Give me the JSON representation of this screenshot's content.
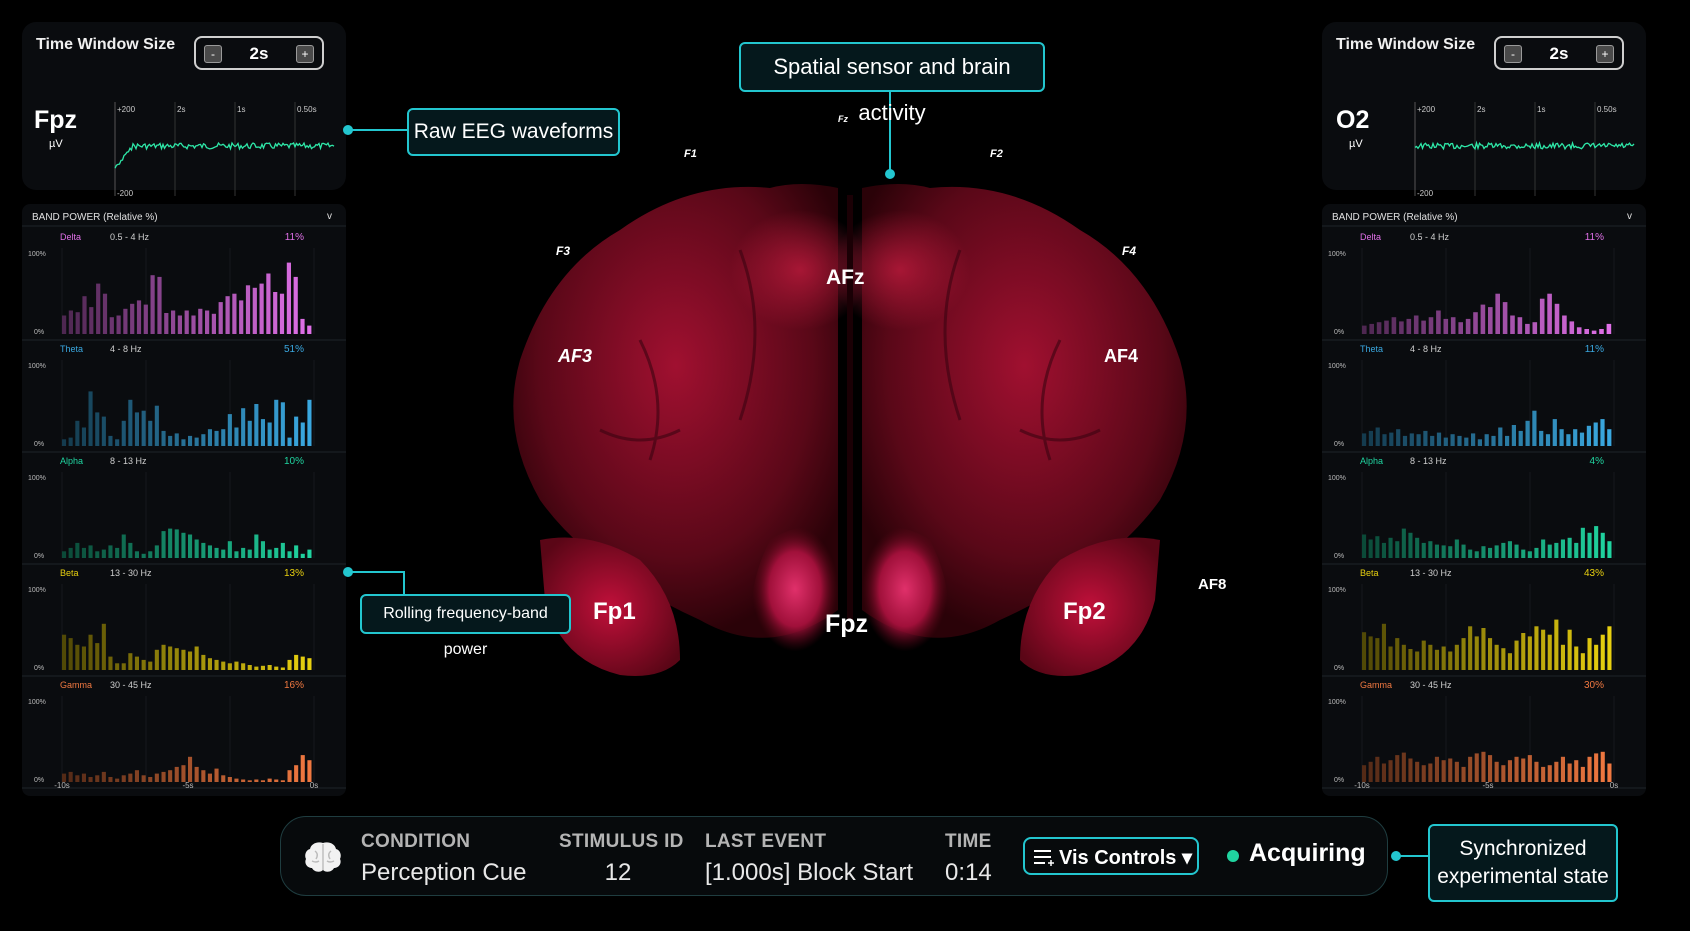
{
  "colors": {
    "accent": "#23c6cf",
    "delta": "#e070e8",
    "theta": "#3aa8e0",
    "alpha": "#20d4a0",
    "beta": "#e8d010",
    "gamma": "#f07840",
    "wave": "#2ee8a8",
    "acquiring_dot": "#20d4a0"
  },
  "left": {
    "time_window_label": "Time Window Size",
    "time_window_value": "2s",
    "minus": "-",
    "plus": "+",
    "channel": "Fpz",
    "unit": "µV",
    "y_top": "+200",
    "y_bottom": "-200",
    "x_ticks": [
      "2s",
      "1s",
      "0.50s"
    ],
    "band_header": "BAND POWER (Relative %)",
    "band_caret": "v",
    "bands": [
      {
        "name": "Delta",
        "range": "0.5 - 4 Hz",
        "pct": "11%",
        "color": "#e070e8",
        "values": [
          22,
          28,
          26,
          45,
          32,
          60,
          48,
          20,
          22,
          30,
          36,
          40,
          35,
          70,
          68,
          25,
          28,
          22,
          28,
          22,
          30,
          28,
          24,
          38,
          45,
          48,
          40,
          58,
          55,
          60,
          72,
          50,
          48,
          85,
          68,
          18,
          10
        ]
      },
      {
        "name": "Theta",
        "range": "4 - 8 Hz",
        "pct": "51%",
        "color": "#3aa8e0",
        "values": [
          8,
          10,
          30,
          22,
          65,
          40,
          35,
          12,
          8,
          30,
          55,
          40,
          42,
          30,
          48,
          18,
          12,
          15,
          8,
          12,
          10,
          14,
          20,
          18,
          20,
          38,
          22,
          45,
          30,
          50,
          32,
          28,
          55,
          52,
          10,
          35,
          28,
          55
        ]
      },
      {
        "name": "Alpha",
        "range": "8 - 13 Hz",
        "pct": "10%",
        "color": "#20d4a0",
        "values": [
          8,
          12,
          18,
          12,
          15,
          8,
          10,
          15,
          12,
          28,
          18,
          8,
          5,
          8,
          15,
          32,
          35,
          34,
          30,
          28,
          22,
          18,
          15,
          12,
          10,
          20,
          8,
          12,
          10,
          28,
          20,
          10,
          12,
          18,
          8,
          15,
          5,
          10
        ]
      },
      {
        "name": "Beta",
        "range": "13 - 30 Hz",
        "pct": "13%",
        "color": "#e8d010",
        "values": [
          42,
          38,
          30,
          28,
          42,
          32,
          55,
          16,
          8,
          8,
          20,
          16,
          12,
          10,
          24,
          30,
          28,
          26,
          24,
          22,
          28,
          18,
          14,
          12,
          10,
          8,
          10,
          8,
          6,
          4,
          5,
          6,
          4,
          3,
          12,
          18,
          16,
          14
        ]
      },
      {
        "name": "Gamma",
        "range": "30 - 45 Hz",
        "pct": "16%",
        "color": "#f07840",
        "values": [
          10,
          12,
          8,
          10,
          6,
          8,
          12,
          6,
          4,
          8,
          10,
          14,
          8,
          6,
          10,
          12,
          14,
          18,
          20,
          30,
          18,
          14,
          10,
          16,
          8,
          6,
          4,
          3,
          2,
          3,
          2,
          4,
          3,
          2,
          14,
          20,
          32,
          26
        ]
      }
    ],
    "x_labels": [
      "-10s",
      "-5s",
      "0s"
    ],
    "y_labels": [
      "100%",
      "0%"
    ]
  },
  "right": {
    "time_window_label": "Time Window Size",
    "time_window_value": "2s",
    "minus": "-",
    "plus": "+",
    "channel": "O2",
    "unit": "µV",
    "y_top": "+200",
    "y_bottom": "-200",
    "x_ticks": [
      "2s",
      "1s",
      "0.50s"
    ],
    "band_header": "BAND POWER (Relative %)",
    "band_caret": "v",
    "bands": [
      {
        "name": "Delta",
        "range": "0.5 - 4 Hz",
        "pct": "11%",
        "color": "#e070e8",
        "values": [
          10,
          12,
          14,
          16,
          20,
          15,
          18,
          22,
          16,
          20,
          28,
          18,
          20,
          14,
          18,
          26,
          35,
          32,
          48,
          38,
          22,
          20,
          12,
          14,
          42,
          48,
          36,
          22,
          15,
          8,
          6,
          4,
          6,
          12
        ]
      },
      {
        "name": "Theta",
        "range": "4 - 8 Hz",
        "pct": "11%",
        "color": "#3aa8e0",
        "values": [
          15,
          18,
          22,
          14,
          16,
          20,
          12,
          15,
          14,
          18,
          12,
          16,
          10,
          14,
          12,
          10,
          15,
          8,
          14,
          12,
          22,
          12,
          25,
          18,
          30,
          42,
          18,
          14,
          32,
          20,
          14,
          20,
          16,
          24,
          28,
          32,
          20
        ]
      },
      {
        "name": "Alpha",
        "range": "8 - 13 Hz",
        "pct": "4%",
        "color": "#20d4a0",
        "values": [
          28,
          22,
          26,
          18,
          24,
          20,
          35,
          30,
          24,
          18,
          20,
          16,
          15,
          14,
          22,
          16,
          10,
          8,
          14,
          12,
          15,
          18,
          20,
          16,
          10,
          8,
          12,
          22,
          16,
          18,
          22,
          24,
          18,
          36,
          30,
          38,
          30,
          20
        ]
      },
      {
        "name": "Beta",
        "range": "13 - 30 Hz",
        "pct": "43%",
        "color": "#e8d010",
        "values": [
          45,
          40,
          38,
          55,
          28,
          38,
          30,
          25,
          22,
          35,
          30,
          24,
          28,
          22,
          30,
          38,
          52,
          40,
          50,
          38,
          30,
          26,
          20,
          35,
          44,
          40,
          52,
          48,
          42,
          60,
          30,
          48,
          28,
          20,
          38,
          30,
          42,
          52
        ]
      },
      {
        "name": "Gamma",
        "range": "30 - 45 Hz",
        "pct": "30%",
        "color": "#f07840",
        "values": [
          20,
          24,
          30,
          22,
          26,
          32,
          35,
          28,
          24,
          20,
          22,
          30,
          26,
          28,
          24,
          18,
          30,
          34,
          36,
          32,
          24,
          20,
          26,
          30,
          28,
          32,
          24,
          18,
          20,
          24,
          30,
          22,
          26,
          18,
          30,
          34,
          36,
          22
        ]
      }
    ],
    "x_labels": [
      "-10s",
      "-5s",
      "0s"
    ],
    "y_labels": [
      "100%",
      "0%"
    ]
  },
  "sensors": {
    "fz": "Fz",
    "f1": "F1",
    "f2": "F2",
    "f3": "F3",
    "f4": "F4",
    "afz": "AFz",
    "af3": "AF3",
    "af4": "AF4",
    "af8": "AF8",
    "fp1": "Fp1",
    "fp2": "Fp2",
    "fpz": "Fpz"
  },
  "callouts": {
    "spatial": "Spatial sensor and brain activity",
    "raw_eeg": "Raw EEG waveforms",
    "rolling": "Rolling frequency-band power",
    "sync_line1": "Synchronized",
    "sync_line2": "experimental state"
  },
  "status": {
    "condition_label": "CONDITION",
    "condition_value": "Perception Cue",
    "stimulus_label": "STIMULUS ID",
    "stimulus_value": "12",
    "event_label": "LAST EVENT",
    "event_value": "[1.000s] Block Start",
    "time_label": "TIME",
    "time_value": "0:14",
    "vis_controls": "Vis Controls ▾",
    "acquiring": "Acquiring"
  },
  "icons": {
    "brain": "brain-icon",
    "menu": "menu-list-icon"
  }
}
